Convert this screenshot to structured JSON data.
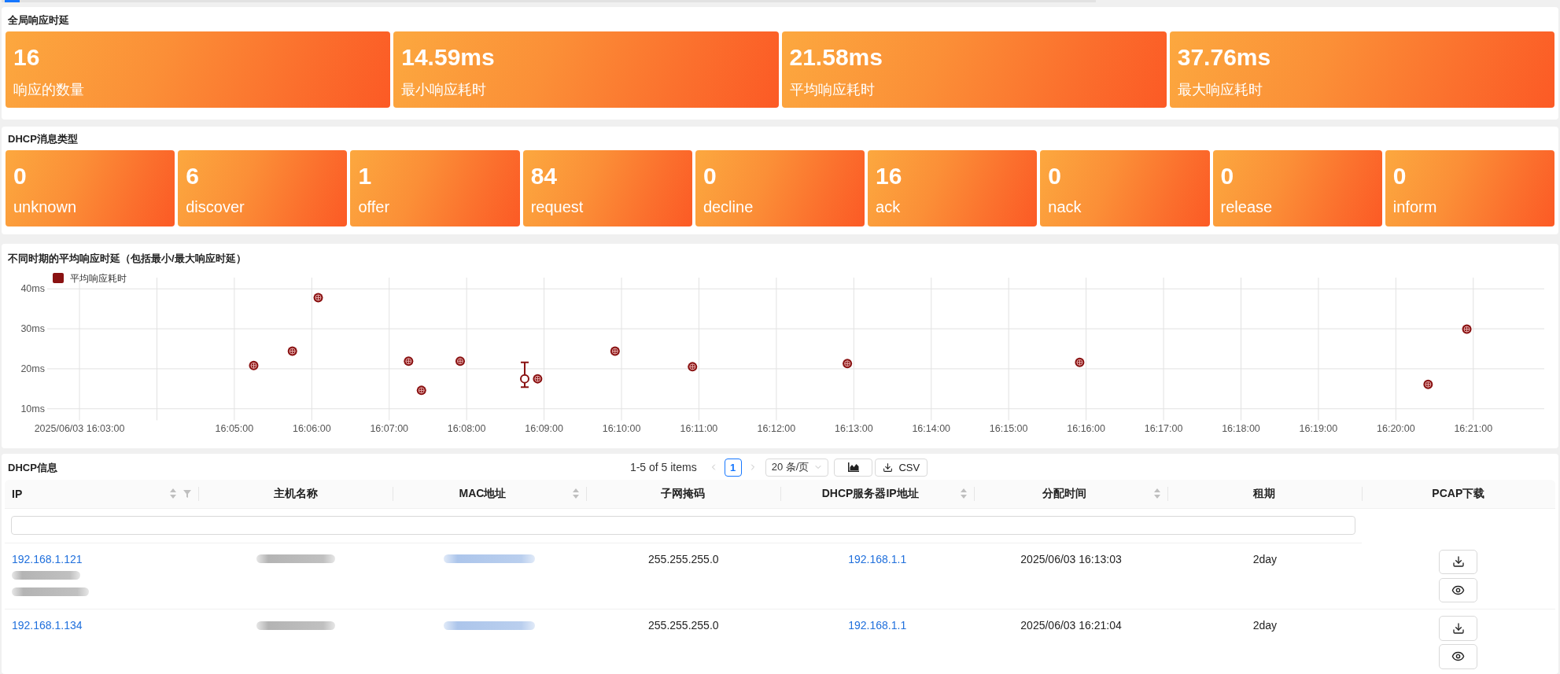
{
  "latency_panel": {
    "title": "全局响应时延",
    "cards": [
      {
        "value": "16",
        "label": "响应的数量"
      },
      {
        "value": "14.59ms",
        "label": "最小响应耗时"
      },
      {
        "value": "21.58ms",
        "label": "平均响应耗时"
      },
      {
        "value": "37.76ms",
        "label": "最大响应耗时"
      }
    ]
  },
  "message_types_panel": {
    "title": "DHCP消息类型",
    "cards": [
      {
        "value": "0",
        "label": "unknown"
      },
      {
        "value": "6",
        "label": "discover"
      },
      {
        "value": "1",
        "label": "offer"
      },
      {
        "value": "84",
        "label": "request"
      },
      {
        "value": "0",
        "label": "decline"
      },
      {
        "value": "16",
        "label": "ack"
      },
      {
        "value": "0",
        "label": "nack"
      },
      {
        "value": "0",
        "label": "release"
      },
      {
        "value": "0",
        "label": "inform"
      }
    ]
  },
  "chart_panel": {
    "title": "不同时期的平均响应时延（包括最小/最大响应时延）",
    "chart_data": {
      "type": "scatter",
      "grid": true,
      "ylim": [
        7.1,
        42.8
      ],
      "yticks": [
        {
          "value": 10,
          "label": "10ms"
        },
        {
          "value": 20,
          "label": "20ms"
        },
        {
          "value": 30,
          "label": "30ms"
        },
        {
          "value": 40,
          "label": "40ms"
        }
      ],
      "categories": [
        null,
        null,
        null,
        null,
        null,
        "2025/06/03 16:03:00",
        null,
        null,
        null,
        null,
        null,
        null,
        null,
        null,
        null,
        null,
        null,
        null,
        null,
        null,
        null,
        null,
        null,
        null,
        null,
        null,
        null,
        null,
        null,
        "16:05:00",
        null,
        null,
        null,
        null,
        null,
        null,
        null,
        null,
        null,
        null,
        null,
        "16:06:00",
        null,
        null,
        null,
        null,
        null,
        null,
        null,
        null,
        null,
        null,
        null,
        "16:07:00",
        null,
        null,
        null,
        null,
        null,
        null,
        null,
        null,
        null,
        null,
        null,
        "16:08:00",
        null,
        null,
        null,
        null,
        null,
        null,
        null,
        null,
        null,
        null,
        null,
        "16:09:00",
        null,
        null,
        null,
        null,
        null,
        null,
        null,
        null,
        null,
        null,
        null,
        "16:10:00",
        null,
        null,
        null,
        null,
        null,
        null,
        null,
        null,
        null,
        null,
        null,
        "16:11:00",
        null,
        null,
        null,
        null,
        null,
        null,
        null,
        null,
        null,
        null,
        null,
        "16:12:00",
        null,
        null,
        null,
        null,
        null,
        null,
        null,
        null,
        null,
        null,
        null,
        "16:13:00",
        null,
        null,
        null,
        null,
        null,
        null,
        null,
        null,
        null,
        null,
        null,
        "16:14:00",
        null,
        null,
        null,
        null,
        null,
        null,
        null,
        null,
        null,
        null,
        null,
        "16:15:00",
        null,
        null,
        null,
        null,
        null,
        null,
        null,
        null,
        null,
        null,
        null,
        "16:16:00",
        null,
        null,
        null,
        null,
        null,
        null,
        null,
        null,
        null,
        null,
        null,
        "16:17:00",
        null,
        null,
        null,
        null,
        null,
        null,
        null,
        null,
        null,
        null,
        null,
        "16:18:00",
        null,
        null,
        null,
        null,
        null,
        null,
        null,
        null,
        null,
        null,
        null,
        "16:19:00",
        null,
        null,
        null,
        null,
        null,
        null,
        null,
        null,
        null,
        null,
        null,
        "16:20:00",
        null,
        null,
        null,
        null,
        null,
        null,
        null,
        null,
        null,
        null,
        null,
        "16:21:00",
        null,
        null,
        null,
        null,
        null,
        null,
        null,
        null,
        null,
        null,
        null
      ],
      "series": [
        {
          "name": "平均响应耗时",
          "color": "#8a1212",
          "values": [
            null,
            null,
            null,
            null,
            null,
            null,
            null,
            null,
            null,
            null,
            null,
            null,
            null,
            null,
            null,
            null,
            null,
            null,
            null,
            null,
            null,
            null,
            null,
            null,
            null,
            null,
            null,
            null,
            null,
            null,
            null,
            null,
            20.8,
            null,
            null,
            null,
            null,
            null,
            24.4,
            null,
            null,
            null,
            37.8,
            null,
            null,
            null,
            null,
            null,
            null,
            null,
            null,
            null,
            null,
            null,
            null,
            null,
            21.9,
            null,
            14.6,
            null,
            null,
            null,
            null,
            null,
            21.9,
            null,
            null,
            null,
            null,
            null,
            null,
            null,
            null,
            null,
            17.5,
            null,
            17.5,
            null,
            null,
            null,
            null,
            null,
            null,
            null,
            null,
            null,
            null,
            null,
            24.4,
            null,
            null,
            null,
            null,
            null,
            null,
            null,
            null,
            null,
            null,
            null,
            20.5,
            null,
            null,
            null,
            null,
            null,
            null,
            null,
            null,
            null,
            null,
            null,
            null,
            null,
            null,
            null,
            null,
            null,
            null,
            null,
            null,
            null,
            null,
            null,
            21.3,
            null,
            null,
            null,
            null,
            null,
            null,
            null,
            null,
            null,
            null,
            null,
            null,
            null,
            null,
            null,
            null,
            null,
            null,
            null,
            null,
            null,
            null,
            null,
            null,
            null,
            null,
            null,
            null,
            null,
            null,
            null,
            null,
            null,
            null,
            null,
            21.6,
            null,
            null,
            null,
            null,
            null,
            null,
            null,
            null,
            null,
            null,
            null,
            null,
            null,
            null,
            null,
            null,
            null,
            null,
            null,
            null,
            null,
            null,
            null,
            null,
            null,
            null,
            null,
            null,
            null,
            null,
            null,
            null,
            null,
            null,
            null,
            null,
            null,
            null,
            null,
            null,
            null,
            null,
            null,
            null,
            null,
            null,
            null,
            null,
            null,
            null,
            null,
            null,
            null,
            16.1,
            null,
            null,
            null,
            null,
            null,
            29.9,
            null,
            null,
            null,
            null,
            null,
            null,
            null,
            null,
            null,
            null,
            null,
            null
          ],
          "errors": [
            null,
            null,
            null,
            null,
            null,
            null,
            null,
            null,
            null,
            null,
            null,
            null,
            null,
            null,
            null,
            null,
            null,
            null,
            null,
            null,
            null,
            null,
            null,
            null,
            null,
            null,
            null,
            null,
            null,
            null,
            null,
            null,
            null,
            null,
            null,
            null,
            null,
            null,
            null,
            null,
            null,
            null,
            null,
            null,
            null,
            null,
            null,
            null,
            null,
            null,
            null,
            null,
            null,
            null,
            null,
            null,
            null,
            null,
            null,
            null,
            null,
            null,
            null,
            null,
            null,
            null,
            null,
            null,
            null,
            null,
            null,
            null,
            null,
            null,
            [
              15.4,
              21.6
            ],
            null,
            null,
            null,
            null,
            null,
            null,
            null,
            null,
            null,
            null,
            null,
            null,
            null,
            null,
            null,
            null,
            null,
            null,
            null,
            null,
            null,
            null,
            null,
            null,
            null,
            null,
            null,
            null,
            null,
            null,
            null,
            null,
            null,
            null,
            null,
            null,
            null,
            null,
            null,
            null,
            null,
            null,
            null,
            null,
            null,
            null,
            null,
            null,
            null,
            null,
            null,
            null,
            null,
            null,
            null,
            null,
            null,
            null,
            null,
            null,
            null,
            null,
            null,
            null,
            null,
            null,
            null,
            null,
            null,
            null,
            null,
            null,
            null,
            null,
            null,
            null,
            null,
            null,
            null,
            null,
            null,
            null,
            null,
            null,
            null,
            null,
            null,
            null,
            null,
            null,
            null,
            null,
            null,
            null,
            null,
            null,
            null,
            null,
            null,
            null,
            null,
            null,
            null,
            null,
            null,
            null,
            null,
            null,
            null,
            null,
            null,
            null,
            null,
            null,
            null,
            null,
            null,
            null,
            null,
            null,
            null,
            null,
            null,
            null,
            null,
            null,
            null,
            null,
            null,
            null,
            null,
            null,
            null,
            null,
            null,
            null,
            null,
            null,
            null,
            null,
            null,
            null,
            null,
            null,
            null,
            null,
            null,
            null,
            null,
            null,
            null,
            null,
            null,
            null,
            null,
            null,
            null,
            null
          ]
        }
      ]
    }
  },
  "table_panel": {
    "title": "DHCP信息",
    "pagination": {
      "summary": "1-5 of 5 items",
      "prev_disabled": true,
      "next_disabled": true,
      "pages": [
        {
          "label": "1",
          "selected": true
        }
      ],
      "page_size": "20 条/页"
    },
    "toolbar_buttons": [
      {
        "kind": "chart"
      },
      {
        "kind": "csv",
        "label": "CSV"
      }
    ],
    "columns": [
      {
        "label": "IP",
        "sortable": true,
        "filterable": true
      },
      {
        "label": "主机名称",
        "sortable": false,
        "filterable": false
      },
      {
        "label": "MAC地址",
        "sortable": true,
        "filterable": false
      },
      {
        "label": "子网掩码",
        "sortable": false,
        "filterable": false
      },
      {
        "label": "DHCP服务器IP地址",
        "sortable": true,
        "filterable": false
      },
      {
        "label": "分配时间",
        "sortable": true,
        "filterable": false
      },
      {
        "label": "租期",
        "sortable": false,
        "filterable": false
      },
      {
        "label": "PCAP下载",
        "sortable": false,
        "filterable": false
      }
    ],
    "rows": [
      {
        "ip": "192.168.1.121",
        "note_blurred": true,
        "host_blurred": true,
        "mac_blurred": true,
        "subnet_mask": "255.255.255.0",
        "dhcp_server": "192.168.1.1",
        "assigned_time": "2025/06/03 16:13:03",
        "lease": "2day",
        "actions": [
          {
            "kind": "download"
          },
          {
            "kind": "preview"
          }
        ]
      },
      {
        "ip": "192.168.1.134",
        "note_blurred": false,
        "host_blurred": true,
        "mac_blurred": true,
        "subnet_mask": "255.255.255.0",
        "dhcp_server": "192.168.1.1",
        "assigned_time": "2025/06/03 16:21:04",
        "lease": "2day",
        "actions": [
          {
            "kind": "download"
          },
          {
            "kind": "preview"
          }
        ]
      }
    ]
  }
}
